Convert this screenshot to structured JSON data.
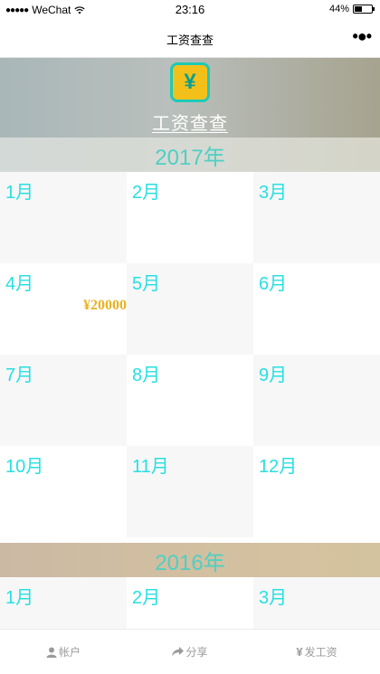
{
  "status_bar": {
    "carrier": "WeChat",
    "time": "23:16",
    "battery": "44%",
    "battery_level": 0.44
  },
  "nav": {
    "title": "工资查查"
  },
  "hero": {
    "logo_symbol": "¥",
    "title": "工资查查"
  },
  "years": [
    {
      "label": "2017年",
      "months": [
        {
          "label": "1月",
          "amount": ""
        },
        {
          "label": "2月",
          "amount": ""
        },
        {
          "label": "3月",
          "amount": ""
        },
        {
          "label": "4月",
          "amount": "¥20000"
        },
        {
          "label": "5月",
          "amount": ""
        },
        {
          "label": "6月",
          "amount": ""
        },
        {
          "label": "7月",
          "amount": ""
        },
        {
          "label": "8月",
          "amount": ""
        },
        {
          "label": "9月",
          "amount": ""
        },
        {
          "label": "10月",
          "amount": ""
        },
        {
          "label": "11月",
          "amount": ""
        },
        {
          "label": "12月",
          "amount": ""
        }
      ]
    },
    {
      "label": "2016年",
      "months": [
        {
          "label": "1月",
          "amount": ""
        },
        {
          "label": "2月",
          "amount": ""
        },
        {
          "label": "3月",
          "amount": ""
        }
      ]
    }
  ],
  "tabs": [
    {
      "label": "帐户",
      "icon": "user-icon"
    },
    {
      "label": "分享",
      "icon": "share-icon"
    },
    {
      "label": "发工资",
      "icon": "yen-icon",
      "glyph": "¥"
    }
  ],
  "colors": {
    "accent": "#27dfe2",
    "amount": "#e8b224",
    "year_text": "#4fcfc3",
    "logo_fill": "#f3c01a",
    "logo_border": "#1ec9b6"
  }
}
